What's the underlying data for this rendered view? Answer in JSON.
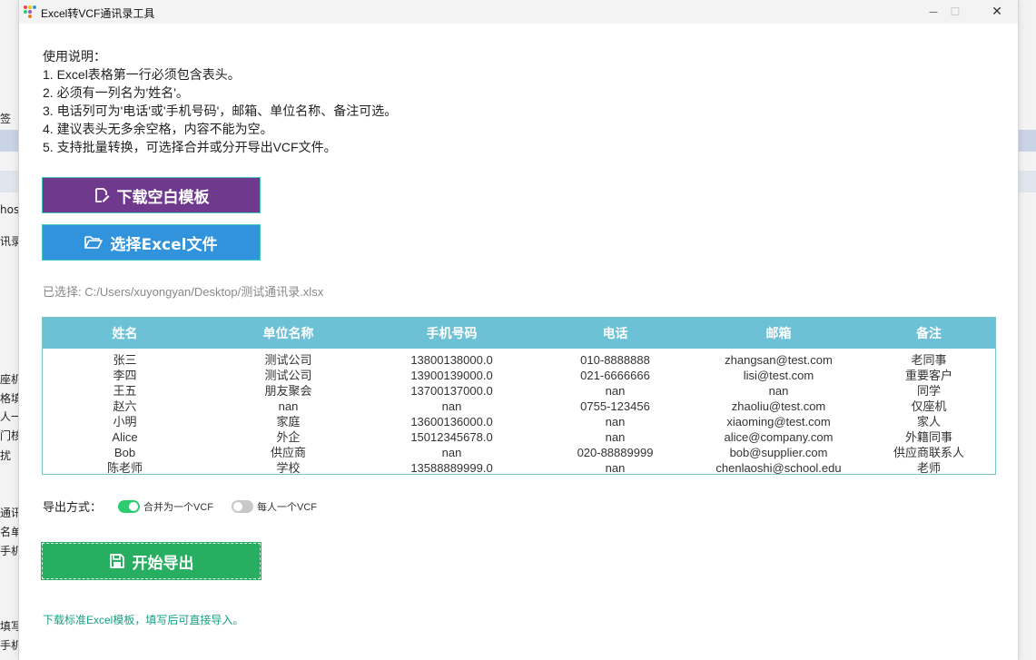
{
  "window": {
    "title": "Excel转VCF通讯录工具",
    "minimize_glyph": "—",
    "maximize_glyph": "☐",
    "close_glyph": "✕"
  },
  "instructions": {
    "heading": "使用说明：",
    "lines": [
      "1. Excel表格第一行必须包含表头。",
      "2. 必须有一列名为'姓名'。",
      "3. 电话列可为'电话'或'手机号码'，邮箱、单位名称、备注可选。",
      "4. 建议表头无多余空格，内容不能为空。",
      "5. 支持批量转换，可选择合并或分开导出VCF文件。"
    ]
  },
  "buttons": {
    "download_template": "下载空白模板",
    "select_excel": "选择Excel文件",
    "start_export": "开始导出"
  },
  "selected_file": "已选择: C:/Users/xuyongyan/Desktop/测试通讯录.xlsx",
  "table": {
    "columns": [
      "姓名",
      "单位名称",
      "手机号码",
      "电话",
      "邮箱",
      "备注"
    ],
    "rows": [
      [
        "张三",
        "测试公司",
        "13800138000.0",
        "010-8888888",
        "zhangsan@test.com",
        "老同事"
      ],
      [
        "李四",
        "测试公司",
        "13900139000.0",
        "021-6666666",
        "lisi@test.com",
        "重要客户"
      ],
      [
        "王五",
        "朋友聚会",
        "13700137000.0",
        "nan",
        "nan",
        "同学"
      ],
      [
        "赵六",
        "nan",
        "nan",
        "0755-123456",
        "zhaoliu@test.com",
        "仅座机"
      ],
      [
        "小明",
        "家庭",
        "13600136000.0",
        "nan",
        "xiaoming@test.com",
        "家人"
      ],
      [
        "Alice",
        "外企",
        "15012345678.0",
        "nan",
        "alice@company.com",
        "外籍同事"
      ],
      [
        "Bob",
        "供应商",
        "nan",
        "020-88889999",
        "bob@supplier.com",
        "供应商联系人"
      ],
      [
        "陈老师",
        "学校",
        "13588889999.0",
        "nan",
        "chenlaoshi@school.edu",
        "老师"
      ]
    ]
  },
  "export_mode": {
    "label": "导出方式：",
    "options": [
      {
        "label": "合并为一个VCF",
        "selected": true
      },
      {
        "label": "每人一个VCF",
        "selected": false
      }
    ]
  },
  "footer_note": "下载标准Excel模板，填写后可直接导入。",
  "background_window": {
    "fragments": [
      "签",
      "hos",
      "讯录",
      "座机",
      "格填",
      "人一",
      "门核",
      "扰",
      "通讯",
      "名单",
      "手机",
      "填写",
      "手机"
    ]
  },
  "colors": {
    "template_button": "#6f3a8e",
    "select_button": "#3193dc",
    "export_button": "#27ae60",
    "table_header": "#6cc1d6",
    "toggle_on": "#2ecc71",
    "toggle_off": "#c8c8c8",
    "footer_text": "#16a085"
  },
  "icons": {
    "template_button": "edit-document-icon",
    "select_button": "folder-open-icon",
    "export_button": "save-icon",
    "app": "app-logo-icon"
  }
}
